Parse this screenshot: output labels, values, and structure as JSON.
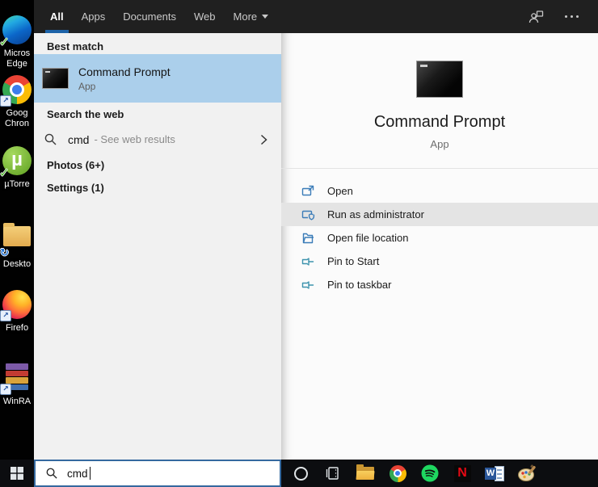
{
  "window": {
    "header": {
      "tabs": [
        {
          "label": "All",
          "active": true
        },
        {
          "label": "Apps",
          "active": false
        },
        {
          "label": "Documents",
          "active": false
        },
        {
          "label": "Web",
          "active": false
        },
        {
          "label": "More",
          "active": false,
          "dropdown": true
        }
      ],
      "icons": [
        "account-icon",
        "more-options-icon"
      ]
    },
    "results": {
      "best_match_header": "Best match",
      "best_match": {
        "title": "Command Prompt",
        "subtitle": "App",
        "icon": "command-prompt-icon",
        "selected": true
      },
      "web_header": "Search the web",
      "web_result": {
        "query": "cmd",
        "suffix": "- See web results",
        "icon": "search-icon",
        "chevron": "chevron-right-icon"
      },
      "group_photos": "Photos (6+)",
      "group_settings": "Settings (1)"
    },
    "preview": {
      "title": "Command Prompt",
      "subtitle": "App",
      "icon": "command-prompt-icon",
      "actions": [
        {
          "label": "Open",
          "icon": "open-icon",
          "highlighted": false
        },
        {
          "label": "Run as administrator",
          "icon": "run-as-admin-shield-icon",
          "highlighted": true
        },
        {
          "label": "Open file location",
          "icon": "file-location-folder-icon",
          "highlighted": false
        },
        {
          "label": "Pin to Start",
          "icon": "pin-icon",
          "highlighted": false
        },
        {
          "label": "Pin to taskbar",
          "icon": "pin-icon",
          "highlighted": false
        }
      ]
    }
  },
  "taskbar": {
    "search": {
      "value": "cmd",
      "icon": "search-icon"
    },
    "buttons": [
      "windows-start-icon",
      "cortana-icon",
      "task-view-icon",
      "file-explorer-icon",
      "chrome-icon",
      "spotify-icon",
      "netflix-icon",
      "word-icon",
      "paint-icon"
    ]
  },
  "desktop": {
    "icons": [
      {
        "name": "microsoft-edge",
        "label_line1": "Micros",
        "label_line2": "Edge"
      },
      {
        "name": "google-chrome",
        "label_line1": "Goog",
        "label_line2": "Chron"
      },
      {
        "name": "utorrent",
        "label_line1": "µTorre",
        "label_line2": ""
      },
      {
        "name": "desktop-folder",
        "label_line1": "Deskto",
        "label_line2": ""
      },
      {
        "name": "firefox",
        "label_line1": "Firefo",
        "label_line2": ""
      },
      {
        "name": "winrar",
        "label_line1": "WinRA",
        "label_line2": ""
      }
    ]
  },
  "colors": {
    "accent_blue": "#1d63a8",
    "best_match_highlight": "#abcfeb",
    "hover_gray": "#e4e4e4",
    "header_bg": "#202020",
    "left_panel_bg": "#f1f1f1",
    "right_panel_bg": "#fbfbfb",
    "taskbar_bg": "#0c0d10",
    "action_icon_blue": "#3b7cb8",
    "pin_icon_teal": "#3d93ad",
    "search_box_border": "#35699f"
  }
}
